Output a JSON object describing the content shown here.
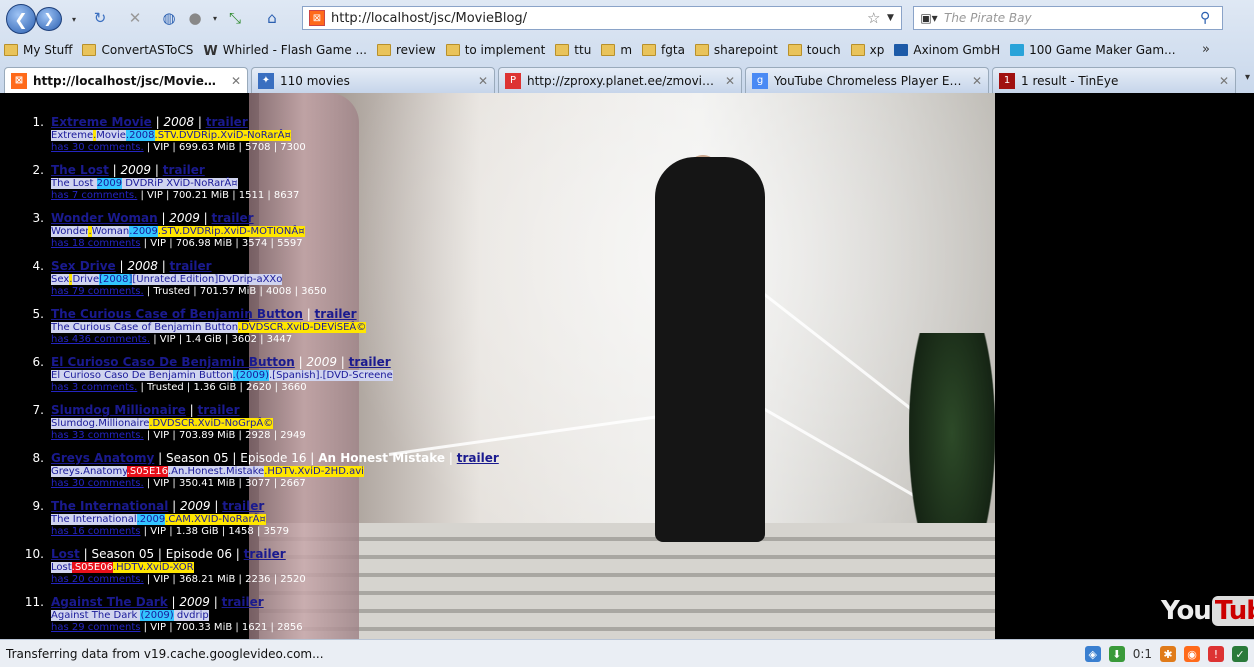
{
  "browser": {
    "url": "http://localhost/jsc/MovieBlog/",
    "search_engine_placeholder": "The Pirate Bay",
    "bookmarks": [
      {
        "label": "My Stuff",
        "icon": "folder-icon"
      },
      {
        "label": "ConvertASToCS",
        "icon": "folder-icon"
      },
      {
        "label": "Whirled - Flash Game ...",
        "icon": "whirled-icon"
      },
      {
        "label": "review",
        "icon": "folder-icon"
      },
      {
        "label": "to implement",
        "icon": "folder-icon"
      },
      {
        "label": "ttu",
        "icon": "folder-icon"
      },
      {
        "label": "m",
        "icon": "folder-icon"
      },
      {
        "label": "fgta",
        "icon": "folder-icon"
      },
      {
        "label": "sharepoint",
        "icon": "folder-icon"
      },
      {
        "label": "touch",
        "icon": "folder-icon"
      },
      {
        "label": "xp",
        "icon": "folder-icon"
      },
      {
        "label": "Axinom GmbH",
        "icon": "axinom-icon"
      },
      {
        "label": "100 Game Maker Gam...",
        "icon": "vimeo-icon"
      }
    ],
    "bookmarks_more": "»",
    "tabs": [
      {
        "label": "http://localhost/jsc/MovieBlog/",
        "active": true,
        "icon": "blog-icon"
      },
      {
        "label": "110 movies",
        "active": false,
        "icon": "accessibility-icon"
      },
      {
        "label": "http://zproxy.planet.ee/zmovies/",
        "active": false,
        "icon": "proxy-icon"
      },
      {
        "label": "YouTube Chromeless Player Examp...",
        "active": false,
        "icon": "google-icon"
      },
      {
        "label": "1 result - TinEye",
        "active": false,
        "icon": "tineye-icon"
      }
    ],
    "status_text": "Transferring data from v19.cache.googlevideo.com...",
    "status_zoom": "0:1"
  },
  "youtube_logo": {
    "you": "You",
    "tube": "Tube"
  },
  "movies": [
    {
      "num": "1.",
      "title": "Extreme Movie",
      "year": "2008",
      "trailer": "trailer",
      "release": [
        "Extreme",
        ".",
        "Movie",
        ".2008",
        ".STV",
        ".DVDRip",
        ".XviD-NoRarÂ¤"
      ],
      "comments": "has 30 comments.",
      "meta": "VIP | 699.63 MiB | 5708 | 7300"
    },
    {
      "num": "2.",
      "title": "The Lost",
      "year": "2009",
      "trailer": "trailer",
      "release": [
        "The Lost ",
        "2009",
        " DVDRiP XViD-NoRarÂ¤"
      ],
      "comments": "has 7 comments.",
      "meta": "VIP | 700.21 MiB | 1511 | 8637"
    },
    {
      "num": "3.",
      "title": "Wonder Woman",
      "year": "2009",
      "trailer": "trailer",
      "release": [
        "Wonder",
        ".",
        "Woman",
        ".2009",
        ".STV",
        ".DVDRip",
        ".XviD-MOTIONÂ¤"
      ],
      "comments": "has 18 comments",
      "meta": "VIP | 706.98 MiB | 3574 | 5597"
    },
    {
      "num": "4.",
      "title": "Sex Drive",
      "year": "2008",
      "trailer": "trailer",
      "release": [
        "Sex",
        ".",
        "Drive",
        "[2008]",
        "[Unrated.Edition]",
        "DvDrip-aXXo"
      ],
      "comments": "has 79 comments.",
      "meta": "Trusted | 701.57 MiB | 4008 | 3650"
    },
    {
      "num": "5.",
      "title": "The Curious Case of Benjamin Button",
      "year": "",
      "trailer": "trailer",
      "release": [
        "The Curious Case of Benjamin Button",
        ".DVDSCR",
        ".XviD-DEViSEÂ©"
      ],
      "comments": "has 436 comments.",
      "meta": "VIP | 1.4 GiB | 3602 | 3447"
    },
    {
      "num": "6.",
      "title": "El Curioso Caso De Benjamin Button",
      "year": "2009",
      "trailer": "trailer",
      "release": [
        "El Curioso Caso De Benjamin Button",
        ".(2009)",
        ".[Spanish]",
        ".[DVD-Screene"
      ],
      "comments": "has 3 comments.",
      "meta": "Trusted | 1.36 GiB | 2620 | 3660"
    },
    {
      "num": "7.",
      "title": "Slumdog Millionaire",
      "year": "",
      "trailer": "trailer",
      "release": [
        "Slumdog",
        ".Millionaire",
        ".DVDSCR",
        ".XviD-NoGrpÂ©"
      ],
      "comments": "has 33 comments.",
      "meta": "VIP | 703.89 MiB | 2928 | 2949"
    },
    {
      "num": "8.",
      "title": "Greys Anatomy",
      "season": "Season 05 | Episode 16 |",
      "episode_title": "An Honest Mistake",
      "trailer": "trailer",
      "release": [
        "Greys",
        ".Anatomy",
        ".S05E16",
        ".An",
        ".Honest",
        ".Mistake",
        ".HDTV",
        ".XviD-2HD",
        ".avi"
      ],
      "comments": "has 30 comments.",
      "meta": "VIP | 350.41 MiB | 3077 | 2667"
    },
    {
      "num": "9.",
      "title": "The International",
      "year": "2009",
      "trailer": "trailer",
      "release": [
        "The International",
        ".2009",
        ".CAM",
        ".XVID-NoRarÂ¤"
      ],
      "comments": "has 16 comments",
      "meta": "VIP | 1.38 GiB | 1458 | 3579"
    },
    {
      "num": "10.",
      "title": "Lost",
      "season": "Season 05 | Episode 06 |",
      "episode_title": "",
      "trailer": "trailer",
      "release": [
        "Lost",
        ".S05E06",
        ".HDTV",
        ".XviD-XOR"
      ],
      "comments": "has 20 comments.",
      "meta": "VIP | 368.21 MiB | 2236 | 2520"
    },
    {
      "num": "11.",
      "title": "Against The Dark",
      "year": "2009",
      "trailer": "trailer",
      "release": [
        "Against The Dark ",
        "(2009)",
        " dvdrip"
      ],
      "comments": "has 29 comments",
      "meta": "VIP | 700.33 MiB | 1621 | 2856"
    }
  ]
}
